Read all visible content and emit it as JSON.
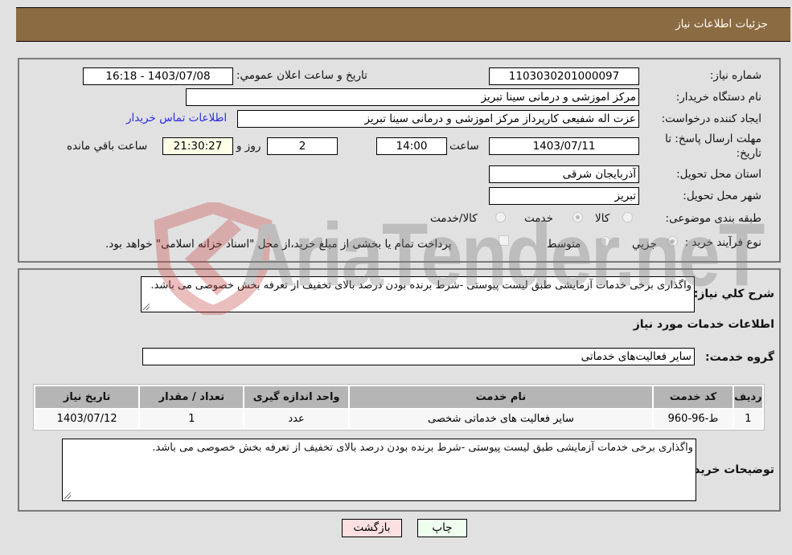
{
  "header": {
    "title": "جزئیات اطلاعات نیاز"
  },
  "form": {
    "need_number": {
      "label": "شماره نیاز:",
      "value": "1103030201000097"
    },
    "announce_datetime": {
      "label": "تاریخ و ساعت اعلان عمومي:",
      "value": "1403/07/08 - 16:18"
    },
    "buyer_org": {
      "label": "نام دستگاه خریدار:",
      "value": "مرکز اموزشی و درمانی سینا تبریز"
    },
    "requester": {
      "label": "ایجاد کننده درخواست:",
      "value": "عزت اله شفیعی  کارپرداز مرکز اموزشی و درمانی سینا تبریز"
    },
    "contact_link": "اطلاعات تماس خریدار",
    "deadline": {
      "label": "مهلت ارسال پاسخ: تا تاریخ:",
      "date": "1403/07/11",
      "time_label": "ساعت",
      "time": "14:00",
      "days": "2",
      "days_label": "روز و",
      "remaining": "21:30:27",
      "remaining_label": "ساعت باقي مانده"
    },
    "province": {
      "label": "استان محل تحویل:",
      "value": "آذربایجان شرقی"
    },
    "city": {
      "label": "شهر محل تحویل:",
      "value": "تبریز"
    },
    "category": {
      "label": "طبقه بندی موضوعی:",
      "options": [
        "کالا",
        "خدمت",
        "کالا/خدمت"
      ],
      "selected": "خدمت"
    },
    "purchase_type": {
      "label": "نوع فرآیند خرید :",
      "options": [
        "جزيي",
        "متوسط"
      ],
      "selected": "جزيي",
      "checkbox_label": "پرداخت تمام یا بخشی از مبلغ خرید،از محل \"اسناد خزانه اسلامی\" خواهد بود.",
      "checkbox_checked": false
    }
  },
  "details": {
    "description_label": "شرح كلي نیاز:",
    "description": "واگذاری برخی خدمات آزمایشی طبق لیست پیوستی -شرط برنده بودن درصد بالای تخفیف از تعرفه بخش خصوصی می باشد.",
    "services_heading": "اطلاعات خدمات مورد نیاز",
    "service_group_label": "گروه خدمت:",
    "service_group": "سایر فعالیت‌های خدماتی",
    "table": {
      "columns": [
        "ردیف",
        "کد خدمت",
        "نام خدمت",
        "واحد اندازه گیری",
        "تعداد / مقدار",
        "تاریخ نیاز"
      ],
      "rows": [
        [
          "1",
          "ط-96-960",
          "سایر فعالیت های خدماتی شخصی",
          "عدد",
          "1",
          "1403/07/12"
        ]
      ]
    },
    "buyer_notes_label": "توضیحات خریدار:",
    "buyer_notes": "واگذاری برخی خدمات آزمایشی طبق لیست پیوستی -شرط برنده بودن درصد بالای تخفیف از تعرفه بخش خصوصی می باشد."
  },
  "buttons": {
    "print": "چاپ",
    "back": "بازگشت"
  },
  "colors": {
    "header_bg": "#8b6b41",
    "print_bg": "#eeffee",
    "back_bg": "#ffe0e0",
    "link": "#2a2ae0"
  },
  "watermark": "AriaTender.neT"
}
